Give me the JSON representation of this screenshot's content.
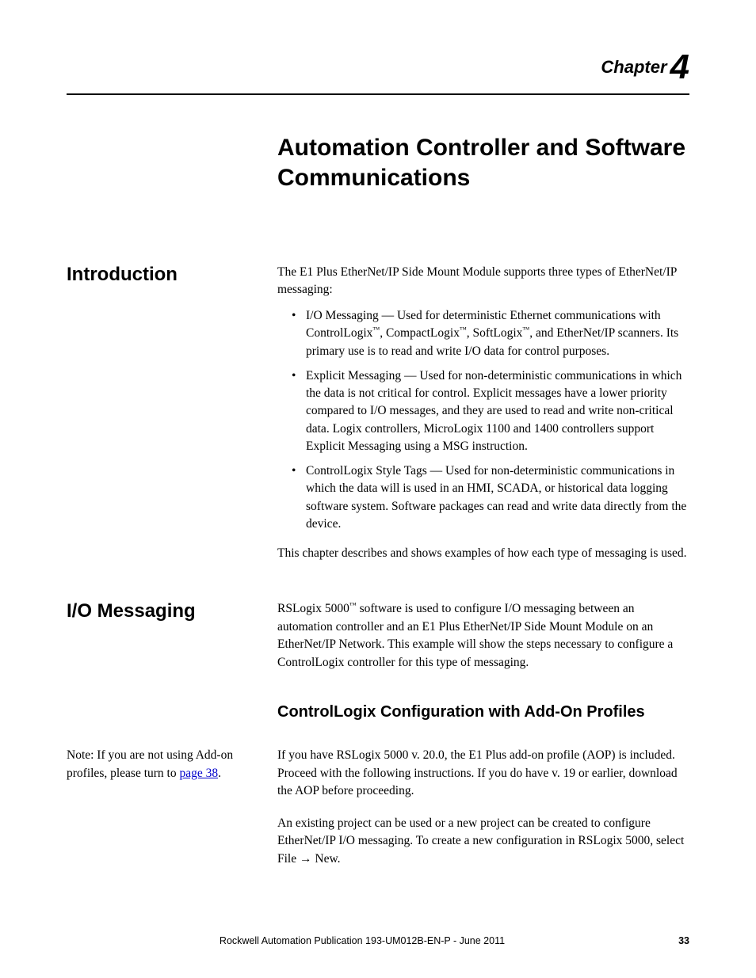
{
  "header": {
    "chapter_label": "Chapter",
    "chapter_number": "4"
  },
  "title": "Automation Controller and Software Communications",
  "sections": {
    "intro": {
      "heading": "Introduction",
      "p1_pre": "The E1 Plus EtherNet/IP Side Mount Module supports three types of EtherNet/IP messaging:",
      "bullets": {
        "b1_pre": "I/O Messaging — Used for deterministic Ethernet communications with ControlLogix",
        "b1_mid1": ", CompactLogix",
        "b1_mid2": ", SoftLogix",
        "b1_post": ", and EtherNet/IP scanners. Its primary use is to read and write I/O data for control purposes.",
        "b2": "Explicit Messaging — Used for non-deterministic communications in which the data is not critical for control. Explicit messages have a lower priority compared to I/O messages, and they are used to read and write non-critical data. Logix controllers, MicroLogix 1100 and 1400 controllers support Explicit Messaging using a MSG instruction.",
        "b3": "ControlLogix Style Tags — Used for non-deterministic communications in which the data will is used in an HMI, SCADA, or historical data logging software system. Software packages can read and write data directly from the device."
      },
      "p2": "This chapter describes and shows examples of how each type of messaging is used."
    },
    "io": {
      "heading": "I/O Messaging",
      "p1_pre": "RSLogix 5000",
      "p1_post": " software is used to configure I/O messaging between an automation controller and an E1 Plus EtherNet/IP Side Mount Module on an EtherNet/IP Network. This example will show the steps necessary to configure a ControlLogix controller for this type of messaging.",
      "subheading": "ControlLogix Configuration with Add-On Profiles",
      "note_pre": "Note: If you are not using Add-on profiles, please turn to ",
      "note_link": "page 38",
      "note_post": ".",
      "p2": "If you have RSLogix 5000 v. 20.0, the E1 Plus add-on profile (AOP) is included. Proceed with the following instructions. If you do have v. 19 or earlier, download the AOP before proceeding.",
      "p3_a": "An existing project can be used or a new project can be created to configure EtherNet/IP I/O messaging. To create a new configuration in RSLogix 5000, select File ",
      "p3_b": " New."
    }
  },
  "footer": {
    "text": "Rockwell Automation Publication 193-UM012B-EN-P - June 2011",
    "page": "33"
  },
  "tm": "™"
}
